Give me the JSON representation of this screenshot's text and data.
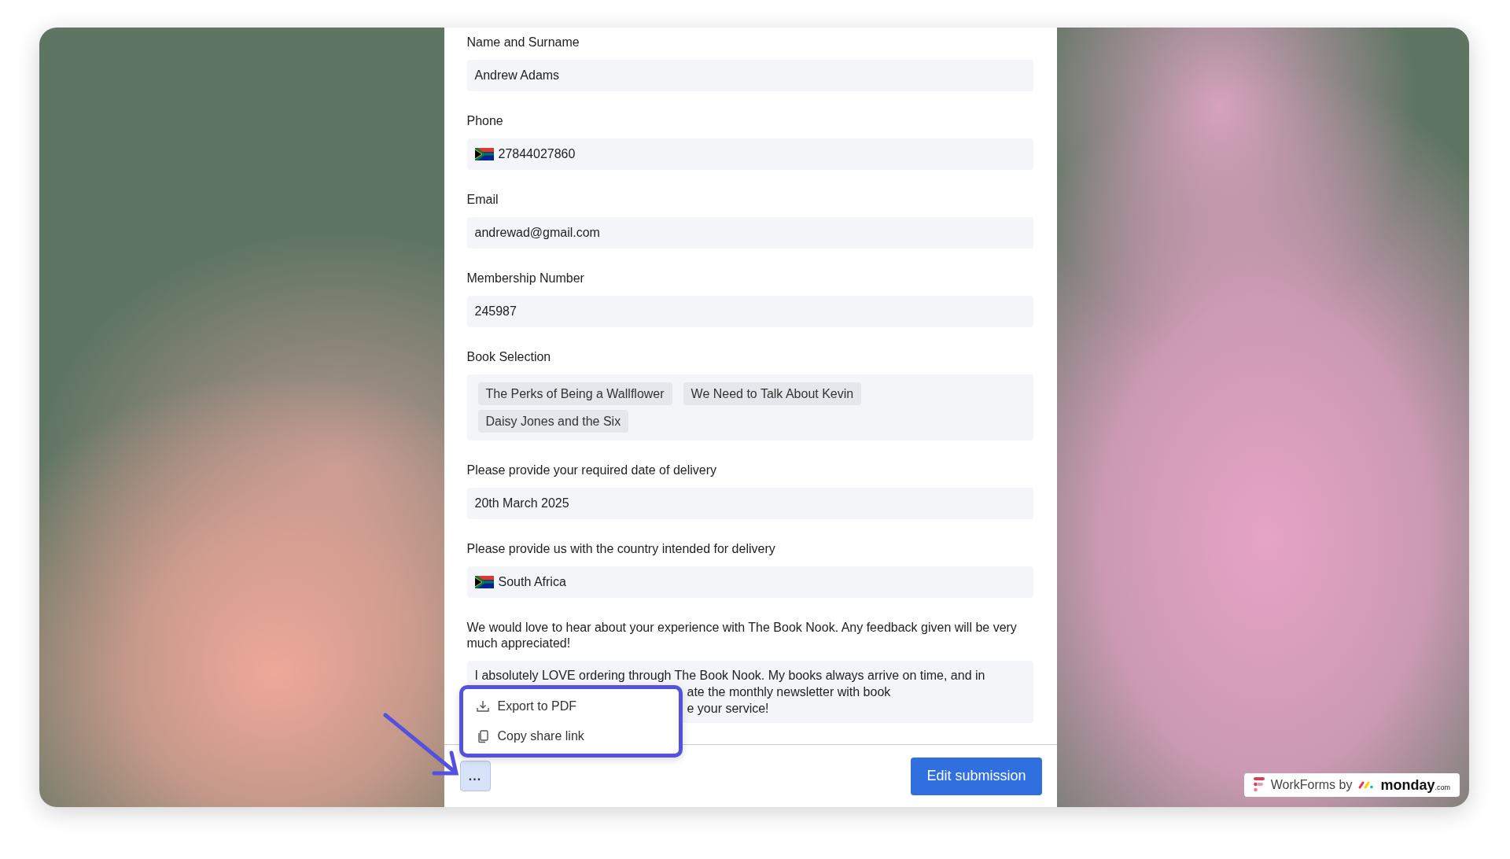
{
  "form": {
    "fields": [
      {
        "kind": "text",
        "label": "Name and Surname",
        "value": "Andrew Adams",
        "flag": false
      },
      {
        "kind": "text",
        "label": "Phone",
        "value": "27844027860",
        "flag": true
      },
      {
        "kind": "text",
        "label": "Email",
        "value": "andrewad@gmail.com",
        "flag": false
      },
      {
        "kind": "text",
        "label": "Membership Number",
        "value": "245987",
        "flag": false
      },
      {
        "kind": "tags",
        "label": "Book Selection",
        "tags": [
          "The Perks of Being a Wallflower",
          "We Need to Talk About Kevin",
          "Daisy Jones and the Six"
        ]
      },
      {
        "kind": "text",
        "label": "Please provide your required date of delivery",
        "value": "20th March 2025",
        "flag": false
      },
      {
        "kind": "text",
        "label": "Please provide us with the country intended for delivery",
        "value": "South Africa",
        "flag": true
      },
      {
        "kind": "textarea",
        "label": "We would love to hear about your experience with The Book Nook. Any feedback given will be very much appreciated!",
        "lines": [
          "I absolutely LOVE ordering through The Book Nook. My books always arrive on time, and in",
          "ate the monthly newsletter with book",
          "e your service!"
        ]
      }
    ]
  },
  "menu": {
    "items": [
      {
        "kind": "export",
        "label": "Export to PDF"
      },
      {
        "kind": "copy",
        "label": "Copy share link"
      }
    ]
  },
  "footer": {
    "more_button": "...",
    "submit_button": "Edit submission"
  },
  "badge": {
    "prefix": "WorkForms by",
    "brand": "monday",
    "brand_suffix": ".com"
  }
}
